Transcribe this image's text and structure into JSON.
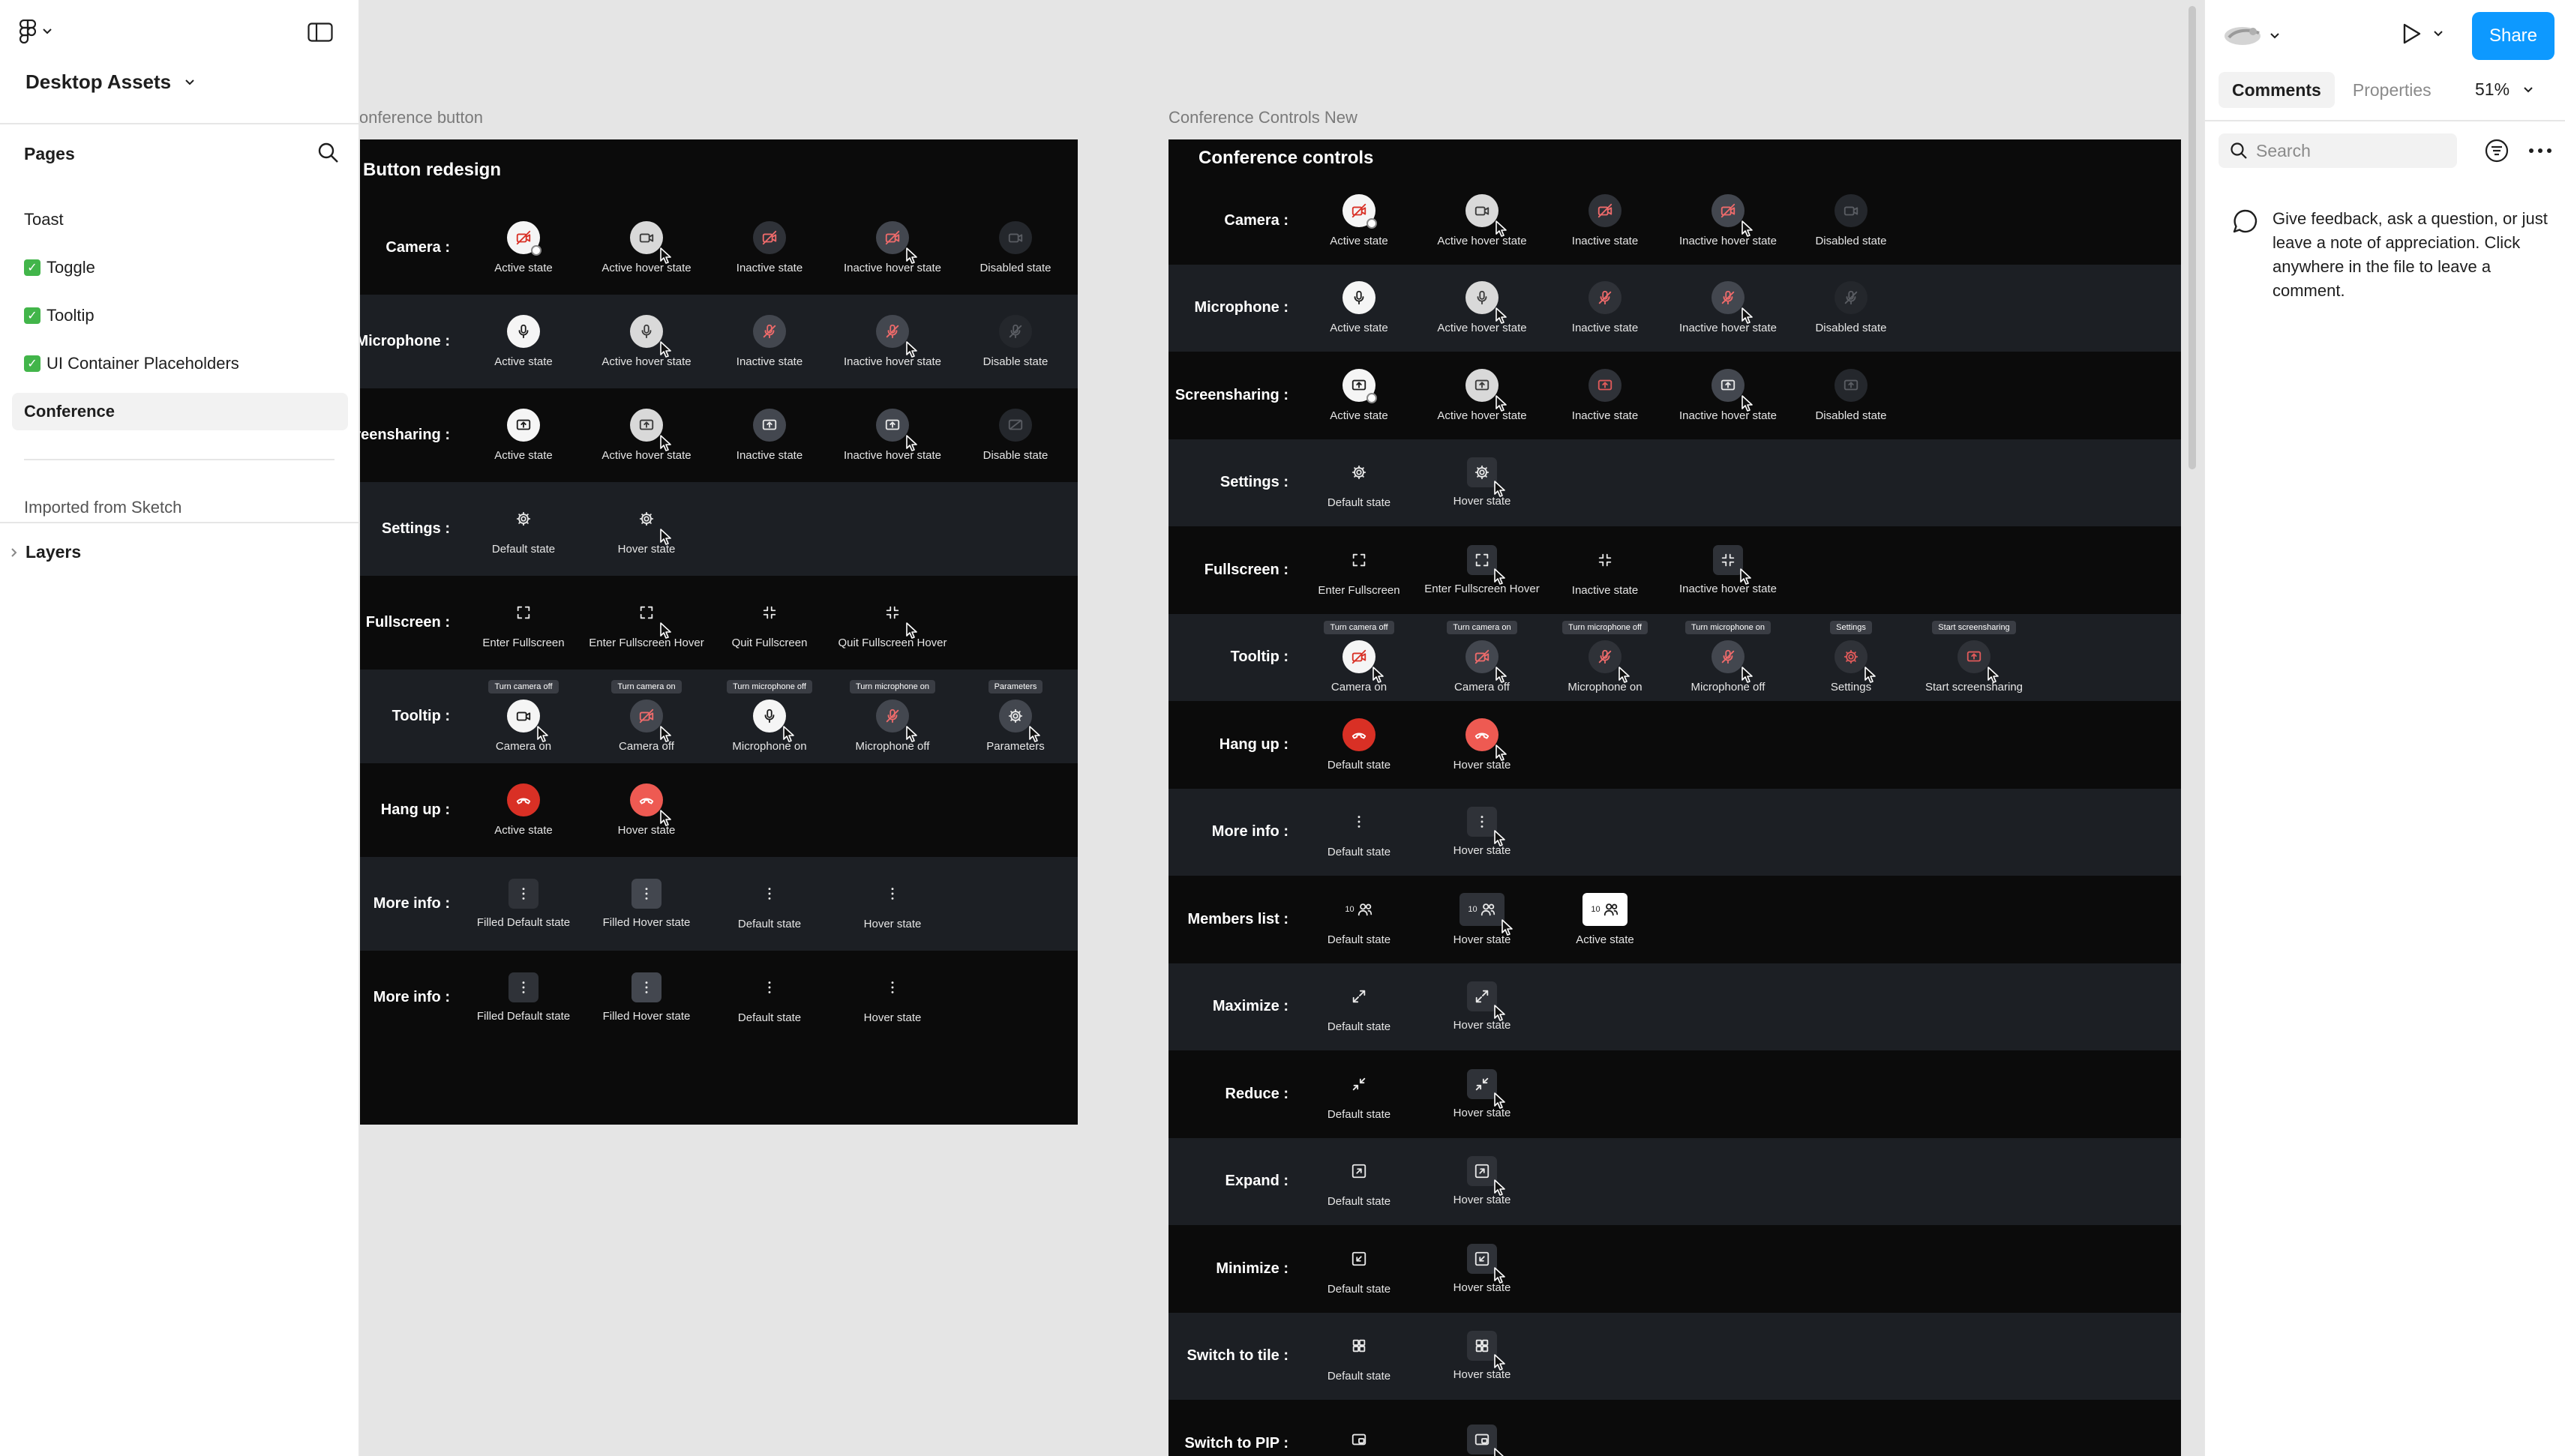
{
  "sidebar": {
    "file_name": "Desktop Assets",
    "pages_label": "Pages",
    "pages": [
      {
        "label": "Toast",
        "checked": false
      },
      {
        "label": "Toggle",
        "checked": true
      },
      {
        "label": "Tooltip",
        "checked": true
      },
      {
        "label": "UI Container Placeholders",
        "checked": true
      },
      {
        "label": "Conference",
        "checked": false,
        "selected": true
      }
    ],
    "imported": "Imported from Sketch",
    "layers_label": "Layers"
  },
  "right_panel": {
    "share_label": "Share",
    "tabs": [
      "Comments",
      "Properties"
    ],
    "zoom": "51%",
    "search_placeholder": "Search",
    "comment_hint": "Give feedback, ask a question, or just leave a note of appreciation. Click anywhere in the file to leave a comment."
  },
  "canvas": {
    "frame_a": {
      "title": "Conference button",
      "header": "Button redesign",
      "rows": [
        {
          "label": "Camera :",
          "cells": [
            {
              "caption": "Active state",
              "icon": "camera-off-icon",
              "style": "white",
              "badge": true
            },
            {
              "caption": "Active hover state",
              "icon": "camera-icon",
              "style": "lgrey",
              "cursor": true
            },
            {
              "caption": "Inactive state",
              "icon": "camera-off-icon",
              "style": "grey"
            },
            {
              "caption": "Inactive hover state",
              "icon": "camera-off-icon",
              "style": "grey2",
              "cursor": true
            },
            {
              "caption": "Disabled state",
              "icon": "camera-icon",
              "style": "dim"
            }
          ]
        },
        {
          "label": "Microphone :",
          "cells": [
            {
              "caption": "Active state",
              "icon": "microphone-icon",
              "style": "white"
            },
            {
              "caption": "Active hover state",
              "icon": "microphone-icon",
              "style": "lgrey",
              "cursor": true
            },
            {
              "caption": "Inactive state",
              "icon": "microphone-off-icon",
              "style": "grey2"
            },
            {
              "caption": "Inactive hover state",
              "icon": "microphone-off-icon",
              "style": "grey2",
              "cursor": true
            },
            {
              "caption": "Disable state",
              "icon": "microphone-off-icon",
              "style": "dim"
            }
          ]
        },
        {
          "label": "Screensharing :",
          "cells": [
            {
              "caption": "Active state",
              "icon": "screenshare-icon",
              "style": "white"
            },
            {
              "caption": "Active hover state",
              "icon": "screenshare-icon",
              "style": "lgrey",
              "cursor": true
            },
            {
              "caption": "Inactive state",
              "icon": "screenshare-icon",
              "style": "grey2"
            },
            {
              "caption": "Inactive hover state",
              "icon": "screenshare-icon",
              "style": "grey2",
              "cursor": true
            },
            {
              "caption": "Disable state",
              "icon": "screenshare-off-icon",
              "style": "dim"
            }
          ]
        },
        {
          "label": "Settings :",
          "cells": [
            {
              "caption": "Default state",
              "icon": "gear-icon",
              "style": "none"
            },
            {
              "caption": "Hover state",
              "icon": "gear-icon",
              "style": "none",
              "cursor": true
            }
          ]
        },
        {
          "label": "Fullscreen :",
          "cells": [
            {
              "caption": "Enter Fullscreen",
              "icon": "enter-fullscreen-icon",
              "style": "none"
            },
            {
              "caption": "Enter Fullscreen Hover",
              "icon": "enter-fullscreen-icon",
              "style": "none",
              "cursor": true
            },
            {
              "caption": "Quit Fullscreen",
              "icon": "quit-fullscreen-icon",
              "style": "none"
            },
            {
              "caption": "Quit Fullscreen Hover",
              "icon": "quit-fullscreen-icon",
              "style": "none",
              "cursor": true
            }
          ]
        },
        {
          "label": "Tooltip :",
          "cells": [
            {
              "caption": "Camera on",
              "tooltip": "Turn camera off",
              "icon": "camera-icon",
              "style": "white",
              "cursor": true
            },
            {
              "caption": "Camera off",
              "tooltip": "Turn camera on",
              "icon": "camera-off-icon",
              "style": "grey2",
              "cursor": true
            },
            {
              "caption": "Microphone on",
              "tooltip": "Turn microphone off",
              "icon": "microphone-icon",
              "style": "white",
              "cursor": true
            },
            {
              "caption": "Microphone off",
              "tooltip": "Turn microphone on",
              "icon": "microphone-off-icon",
              "style": "grey2",
              "cursor": true
            },
            {
              "caption": "Parameters",
              "tooltip": "Parameters",
              "icon": "gear-icon",
              "style": "grey2",
              "cursor": true
            }
          ]
        },
        {
          "label": "Hang up :",
          "cells": [
            {
              "caption": "Active state",
              "icon": "hang-up-icon",
              "style": "red"
            },
            {
              "caption": "Hover state",
              "icon": "hang-up-icon",
              "style": "red2",
              "cursor": true
            }
          ]
        },
        {
          "label": "More info :",
          "cells": [
            {
              "caption": "Filled Default state",
              "icon": "more-vertical-icon",
              "style": "sq-grey"
            },
            {
              "caption": "Filled Hover state",
              "icon": "more-vertical-icon",
              "style": "sq-grey2"
            },
            {
              "caption": "Default state",
              "icon": "more-vertical-icon",
              "style": "none"
            },
            {
              "caption": "Hover state",
              "icon": "more-vertical-icon",
              "style": "none"
            }
          ]
        },
        {
          "label": "More info :",
          "cells": [
            {
              "caption": "Filled Default state",
              "icon": "more-vertical-icon",
              "style": "sq-grey"
            },
            {
              "caption": "Filled Hover state",
              "icon": "more-vertical-icon",
              "style": "sq-grey2"
            },
            {
              "caption": "Default state",
              "icon": "more-vertical-icon",
              "style": "none"
            },
            {
              "caption": "Hover state",
              "icon": "more-vertical-icon",
              "style": "none"
            }
          ]
        }
      ]
    },
    "frame_b": {
      "title": "Conference Controls New",
      "header": "Conference controls",
      "rows": [
        {
          "label": "Camera :",
          "cells": [
            {
              "caption": "Active state",
              "icon": "camera-off-icon",
              "style": "white",
              "badge": true
            },
            {
              "caption": "Active hover state",
              "icon": "camera-icon",
              "style": "lgrey",
              "cursor": true
            },
            {
              "caption": "Inactive state",
              "icon": "camera-off-icon",
              "style": "grey"
            },
            {
              "caption": "Inactive hover state",
              "icon": "camera-off-icon",
              "style": "grey2",
              "cursor": true
            },
            {
              "caption": "Disabled state",
              "icon": "camera-icon",
              "style": "dim"
            }
          ]
        },
        {
          "label": "Microphone :",
          "cells": [
            {
              "caption": "Active state",
              "icon": "microphone-icon",
              "style": "white"
            },
            {
              "caption": "Active hover state",
              "icon": "microphone-icon",
              "style": "lgrey",
              "cursor": true
            },
            {
              "caption": "Inactive state",
              "icon": "microphone-off-icon",
              "style": "grey"
            },
            {
              "caption": "Inactive hover state",
              "icon": "microphone-off-icon",
              "style": "grey2",
              "cursor": true
            },
            {
              "caption": "Disabled state",
              "icon": "microphone-off-icon",
              "style": "dim"
            }
          ]
        },
        {
          "label": "Screensharing :",
          "cells": [
            {
              "caption": "Active state",
              "icon": "screenshare-icon",
              "style": "white",
              "badge": true
            },
            {
              "caption": "Active hover state",
              "icon": "screenshare-icon",
              "style": "lgrey",
              "cursor": true
            },
            {
              "caption": "Inactive state",
              "icon": "screenshare-icon",
              "style": "grey"
            },
            {
              "caption": "Inactive hover state",
              "icon": "screenshare-icon",
              "style": "grey2",
              "cursor": true
            },
            {
              "caption": "Disabled state",
              "icon": "screenshare-icon",
              "style": "dim"
            }
          ]
        },
        {
          "label": "Settings :",
          "cells": [
            {
              "caption": "Default state",
              "icon": "gear-icon",
              "style": "none"
            },
            {
              "caption": "Hover state",
              "icon": "gear-icon",
              "style": "sq-grey",
              "cursor": true
            }
          ]
        },
        {
          "label": "Fullscreen :",
          "cells": [
            {
              "caption": "Enter Fullscreen",
              "icon": "enter-fullscreen-icon",
              "style": "none"
            },
            {
              "caption": "Enter Fullscreen Hover",
              "icon": "enter-fullscreen-icon",
              "style": "sq-grey",
              "cursor": true
            },
            {
              "caption": "Inactive state",
              "icon": "quit-fullscreen-icon",
              "style": "none"
            },
            {
              "caption": "Inactive hover state",
              "icon": "quit-fullscreen-icon",
              "style": "sq-grey",
              "cursor": true
            }
          ]
        },
        {
          "label": "Tooltip :",
          "cells": [
            {
              "caption": "Camera on",
              "tooltip": "Turn camera off",
              "icon": "camera-off-icon",
              "style": "white",
              "cursor": true
            },
            {
              "caption": "Camera off",
              "tooltip": "Turn camera on",
              "icon": "camera-off-icon",
              "style": "grey2",
              "cursor": true
            },
            {
              "caption": "Microphone on",
              "tooltip": "Turn microphone off",
              "icon": "microphone-off-icon",
              "style": "grey",
              "cursor": true
            },
            {
              "caption": "Microphone off",
              "tooltip": "Turn microphone on",
              "icon": "microphone-off-icon",
              "style": "grey2",
              "cursor": true
            },
            {
              "caption": "Settings",
              "tooltip": "Settings",
              "icon": "gear-icon",
              "style": "grey",
              "cursor": true
            },
            {
              "caption": "Start screensharing",
              "tooltip": "Start screensharing",
              "icon": "screenshare-icon",
              "style": "grey",
              "cursor": true
            }
          ]
        },
        {
          "label": "Hang up :",
          "cells": [
            {
              "caption": "Default state",
              "icon": "hang-up-icon",
              "style": "red"
            },
            {
              "caption": "Hover state",
              "icon": "hang-up-icon",
              "style": "red2",
              "cursor": true
            }
          ]
        },
        {
          "label": "More info :",
          "cells": [
            {
              "caption": "Default state",
              "icon": "more-vertical-icon",
              "style": "none"
            },
            {
              "caption": "Hover state",
              "icon": "more-vertical-icon",
              "style": "sq-grey",
              "cursor": true
            }
          ]
        },
        {
          "label": "Members list :",
          "cells": [
            {
              "caption": "Default state",
              "icon": "members-icon",
              "style": "pill",
              "count": "10"
            },
            {
              "caption": "Hover state",
              "icon": "members-icon",
              "style": "pill-grey",
              "count": "10",
              "cursor": true
            },
            {
              "caption": "Active state",
              "icon": "members-icon",
              "style": "pill-white",
              "count": "10"
            }
          ]
        },
        {
          "label": "Maximize :",
          "cells": [
            {
              "caption": "Default state",
              "icon": "maximize-icon",
              "style": "none"
            },
            {
              "caption": "Hover state",
              "icon": "maximize-icon",
              "style": "sq-grey",
              "cursor": true
            }
          ]
        },
        {
          "label": "Reduce :",
          "cells": [
            {
              "caption": "Default state",
              "icon": "reduce-icon",
              "style": "none"
            },
            {
              "caption": "Hover state",
              "icon": "reduce-icon",
              "style": "sq-grey",
              "cursor": true
            }
          ]
        },
        {
          "label": "Expand :",
          "cells": [
            {
              "caption": "Default state",
              "icon": "expand-icon",
              "style": "none"
            },
            {
              "caption": "Hover state",
              "icon": "expand-icon",
              "style": "sq-grey",
              "cursor": true
            }
          ]
        },
        {
          "label": "Minimize :",
          "cells": [
            {
              "caption": "Default state",
              "icon": "minimize-icon",
              "style": "none"
            },
            {
              "caption": "Hover state",
              "icon": "minimize-icon",
              "style": "sq-grey",
              "cursor": true
            }
          ]
        },
        {
          "label": "Switch to tile :",
          "cells": [
            {
              "caption": "Default state",
              "icon": "tile-icon",
              "style": "none"
            },
            {
              "caption": "Hover state",
              "icon": "tile-icon",
              "style": "sq-grey",
              "cursor": true
            }
          ]
        },
        {
          "label": "Switch to PIP :",
          "cells": [
            {
              "caption": "",
              "icon": "pip-icon",
              "style": "none"
            },
            {
              "caption": "",
              "icon": "pip-icon",
              "style": "sq-grey",
              "cursor": true
            }
          ]
        }
      ]
    }
  }
}
